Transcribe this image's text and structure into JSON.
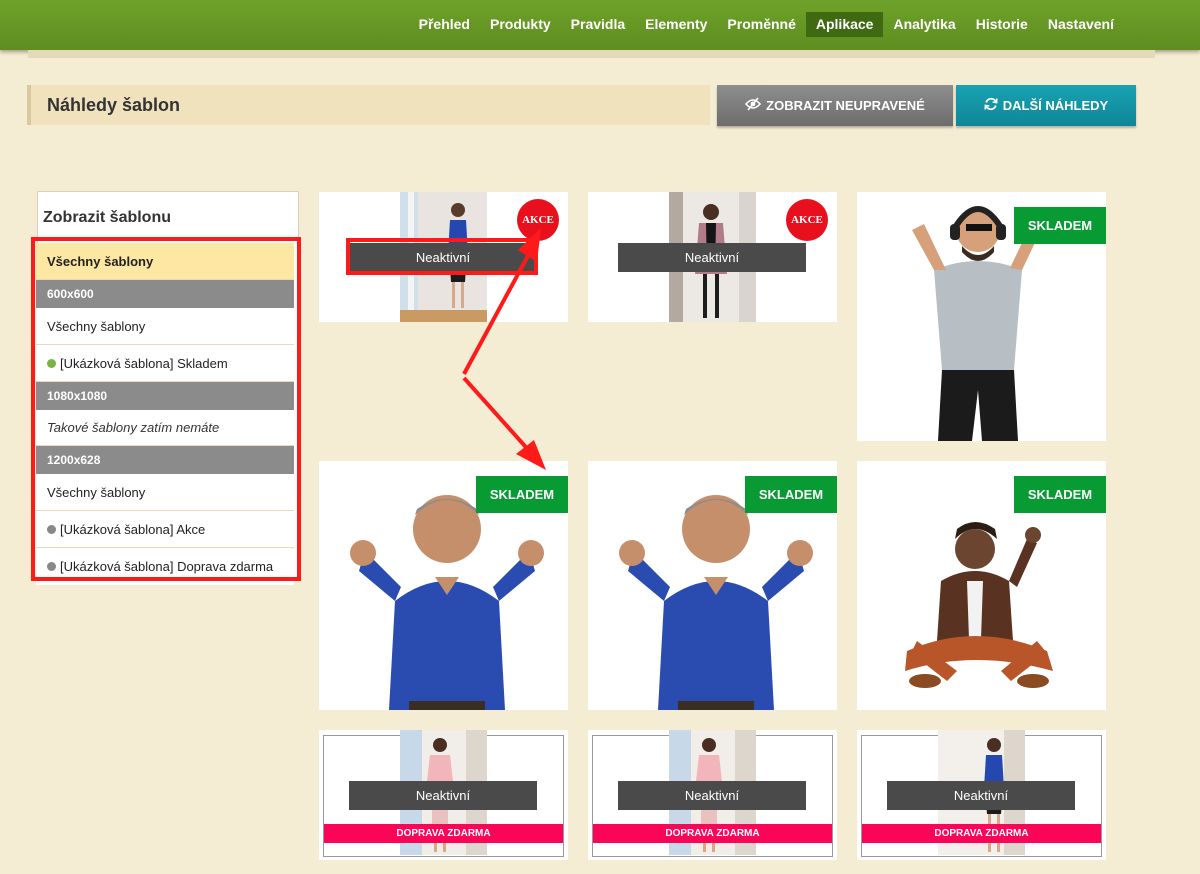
{
  "nav": {
    "items": [
      "Přehled",
      "Produkty",
      "Pravidla",
      "Elementy",
      "Proměnné",
      "Aplikace",
      "Analytika",
      "Historie",
      "Nastavení"
    ],
    "active": "Aplikace"
  },
  "header": {
    "title": "Náhledy šablon",
    "btn_unedited": "ZOBRAZIT NEUPRAVENÉ",
    "btn_more": "DALŠÍ NÁHLEDY",
    "btn_unedited_icon": "eye-slash-icon",
    "btn_more_icon": "refresh-icon"
  },
  "sidebar": {
    "title": "Zobrazit šablonu",
    "selected": "Všechny šablony",
    "group_600": "600x600",
    "all_600": "Všechny šablony",
    "item_skladem": "[Ukázková šablona] Skladem",
    "group_1080": "1080x1080",
    "note_1080": "Takové šablony zatím nemáte",
    "group_1200": "1200x628",
    "all_1200": "Všechny šablony",
    "item_akce": "[Ukázková šablona] Akce",
    "item_doprava": "[Ukázková šablona] Doprava zdarma"
  },
  "cards": {
    "inactive": "Neaktivní",
    "akce": "AKCE",
    "skladem": "SKLADEM",
    "doprava": "DOPRAVA ZDARMA"
  },
  "colors": {
    "nav_green": "#6fa22a",
    "skladem_green": "#089a33",
    "akce_red": "#e8101d",
    "doprava_pink": "#fa0557",
    "annotation_red": "#ff1a1a",
    "dot_green": "#7cb342",
    "dot_gray": "#888888"
  }
}
